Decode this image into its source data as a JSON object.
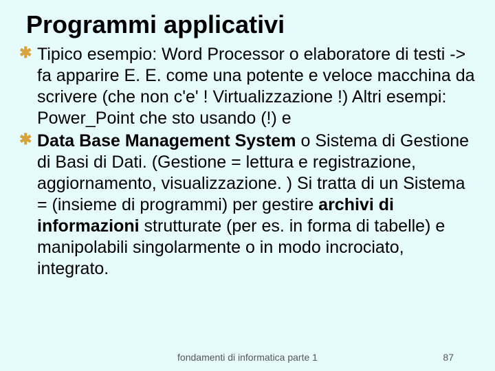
{
  "title": "Programmi applicativi",
  "bullets": [
    {
      "prefix": "Tipico esempio:",
      "rest": " Word Processor o elaboratore di testi -> fa apparire E. E.  come una potente e veloce macchina da scrivere (che non c'e' !  Virtualizzazione !)  Altri esempi: Power_Point che sto usando (!) e"
    },
    {
      "boldA": "Data Base Management System",
      "mid1": " o Sistema di Gestione di Basi di Dati. (Gestione = lettura e registrazione, aggiornamento, visualizzazione. ) Si tratta di un Sistema = (insieme di programmi) per gestire  ",
      "boldB": "archivi di informazioni",
      "mid2": " strutturate (per es. in forma di tabelle) e manipolabili singolarmente o in modo incrociato, integrato."
    }
  ],
  "footer_center": "fondamenti di informatica parte 1",
  "footer_page": "87",
  "bullet_glyph": "✱"
}
